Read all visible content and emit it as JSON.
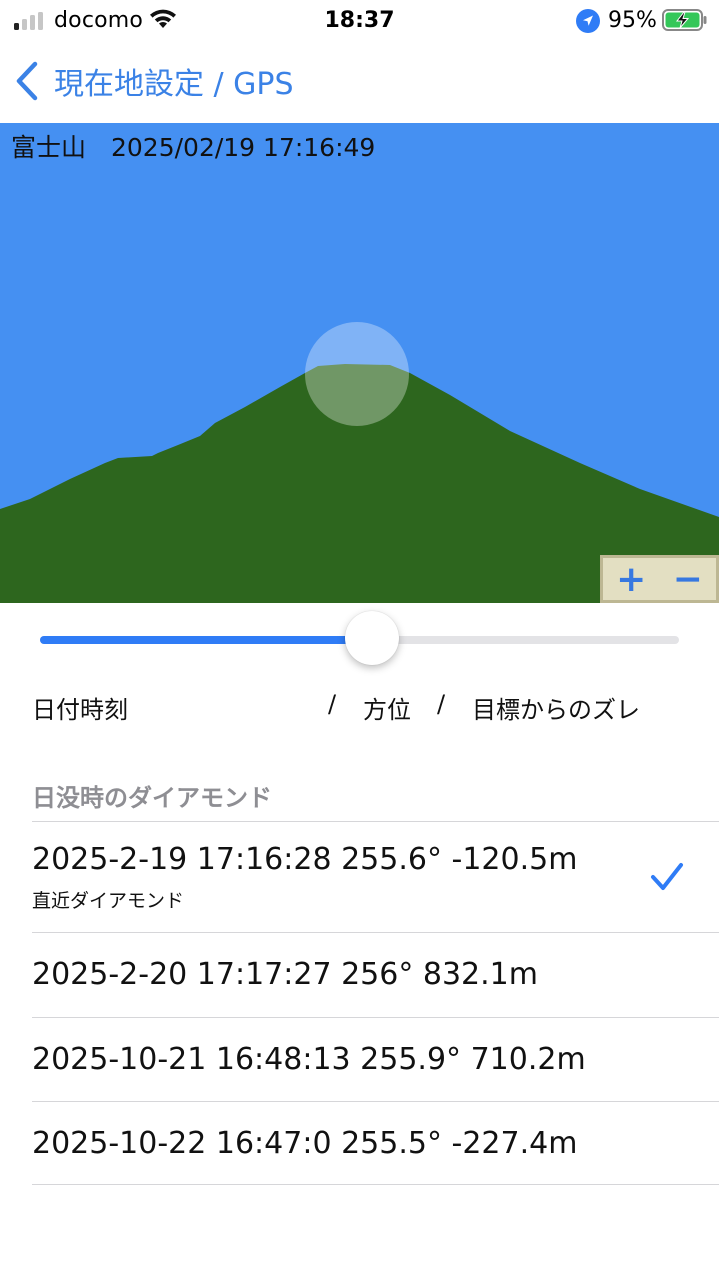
{
  "status_bar": {
    "carrier": "docomo",
    "time": "18:37",
    "battery_percent": "95%",
    "signal_bars_on": 1,
    "icons": [
      "signal-icon",
      "wifi-icon",
      "location-arrow-icon",
      "battery-charging-icon"
    ]
  },
  "nav": {
    "back_icon": "chevron-left-icon",
    "title": "現在地設定 / GPS"
  },
  "viewer": {
    "caption": "富士山　2025/02/19 17:16:49",
    "sky_color": "#4590f2",
    "mountain_color": "#2d661e",
    "zoom_in": "+",
    "zoom_out": "−"
  },
  "slider": {
    "value_fraction": 0.52,
    "accent": "#2f7cf6"
  },
  "columns": {
    "datetime": "日付時刻",
    "sep1": "/",
    "azimuth": "方位",
    "sep2": "/",
    "deviation": "目標からのズレ"
  },
  "section": {
    "title": "日没時のダイアモンド"
  },
  "rows": [
    {
      "text": "2025-2-19  17:16:28  255.6°  -120.5m",
      "subtitle": "直近ダイアモンド",
      "selected": true
    },
    {
      "text": "2025-2-20  17:17:27  256°  832.1m",
      "subtitle": "",
      "selected": false
    },
    {
      "text": "2025-10-21  16:48:13  255.9°  710.2m",
      "subtitle": "",
      "selected": false
    },
    {
      "text": "2025-10-22  16:47:0  255.5°  -227.4m",
      "subtitle": "",
      "selected": false
    }
  ]
}
